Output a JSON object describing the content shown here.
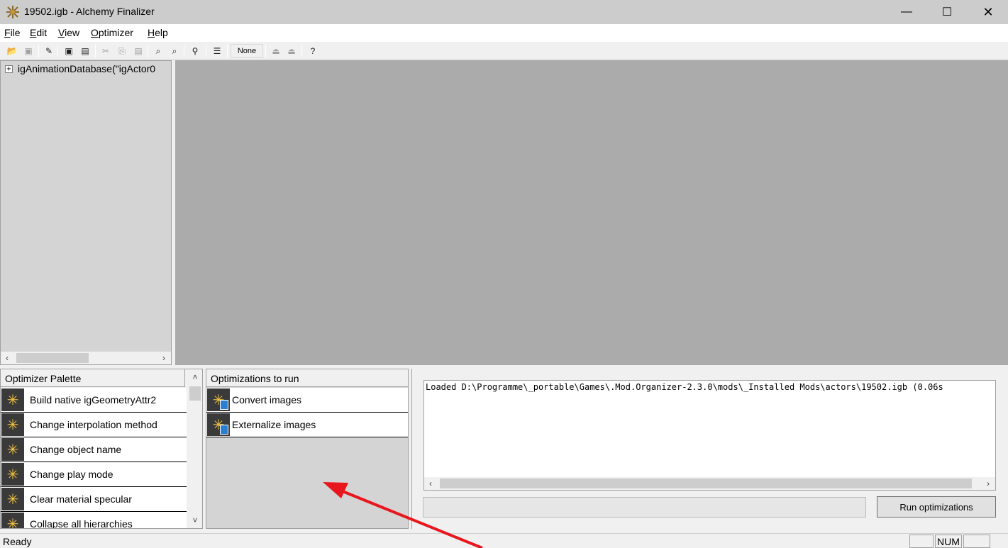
{
  "window": {
    "title": "19502.igb - Alchemy Finalizer",
    "minimize": "—",
    "maximize": "☐",
    "close": "✕"
  },
  "menu": {
    "items": [
      {
        "label": "File",
        "accel": "F",
        "rest": "ile"
      },
      {
        "label": "Edit",
        "accel": "E",
        "rest": "dit"
      },
      {
        "label": "View",
        "accel": "V",
        "rest": "iew"
      },
      {
        "label": "Optimizer",
        "accel": "O",
        "rest": "ptimizer"
      },
      {
        "label": "Help",
        "accel": "H",
        "rest": "elp"
      }
    ]
  },
  "toolbar": {
    "buttons": [
      "open-icon",
      "save-icon",
      "edit-icon",
      "save-all-icon",
      "properties-icon",
      "cut-icon",
      "copy-icon",
      "paste-icon",
      "find-icon",
      "find-next-icon",
      "link-icon",
      "list-icon",
      "move-up-icon",
      "move-down-icon",
      "help-icon"
    ],
    "none_label": "None"
  },
  "tree": {
    "expander": "+",
    "node_label": "igAnimationDatabase(\"igActor0"
  },
  "palette": {
    "header": "Optimizer Palette",
    "items": [
      "Build native igGeometryAttr2",
      "Change interpolation method",
      "Change object name",
      "Change play mode",
      "Clear material specular",
      "Collapse all hierarchies"
    ]
  },
  "optimizations": {
    "header": "Optimizations to run",
    "items": [
      "Convert images",
      "Externalize images"
    ]
  },
  "log": {
    "text": "Loaded D:\\Programme\\_portable\\Games\\.Mod.Organizer-2.3.0\\mods\\_Installed Mods\\actors\\19502.igb (0.06s"
  },
  "run_button": "Run optimizations",
  "status": {
    "text": "Ready",
    "num": "NUM"
  },
  "colors": {
    "annotation_arrow": "#e8171e",
    "view_bg": "#ababab",
    "icon_bg": "#3a3a3a"
  }
}
